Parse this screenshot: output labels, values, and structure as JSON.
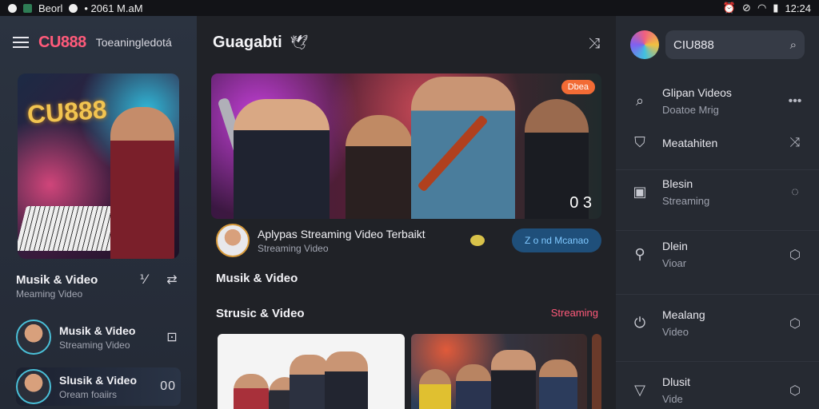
{
  "statusbar": {
    "left_text": "Beorl",
    "time_left": "• 2061 M.aM",
    "time_right": "12:24"
  },
  "left": {
    "brand": "CU888",
    "brand_sub": "Toeaningledotá",
    "hero_logo": "CU888",
    "section_title": "Musik & Video",
    "section_sub": "Meaming Video",
    "rows": [
      {
        "title": "Musik & Video",
        "sub": "Streaming Video",
        "action": "⊡"
      },
      {
        "title": "Slusik & Video",
        "sub": "Oream foaiirs",
        "action": "00"
      }
    ]
  },
  "center": {
    "title": "Guagabti",
    "hero_badge": "Dbea",
    "hero_duration": "0 3",
    "info_title": "Aplypas Streaming Video Terbaikt",
    "info_sub": "Streaming Video",
    "pill": "Z o nd Mcanao",
    "section1": "Musik & Video",
    "section2": "Strusic & Video",
    "section2_link": "Streaming"
  },
  "right": {
    "search_text": "CIU888",
    "items": [
      {
        "icon": "search-icon",
        "title": "Glipan Videos",
        "sub": "Doatoe Mrig",
        "action": "•••"
      },
      {
        "icon": "shield-icon",
        "title": "Meatahiten",
        "sub": "",
        "action": "⤨"
      },
      {
        "icon": "image-icon",
        "title": "Blesin",
        "sub": "Streaming",
        "action": "◌"
      },
      {
        "icon": "pin-icon",
        "title": "Dlein",
        "sub": "Vioar",
        "action": "⬡"
      },
      {
        "icon": "power-icon",
        "title": "Mealang",
        "sub": "Video",
        "action": "⬡"
      },
      {
        "icon": "send-icon",
        "title": "Dlusit",
        "sub": "Vide",
        "action": "⬡"
      }
    ]
  },
  "colors": {
    "brand": "#ff5a7a",
    "pill_bg": "#1f4f7a",
    "badge": "#f26b35"
  }
}
